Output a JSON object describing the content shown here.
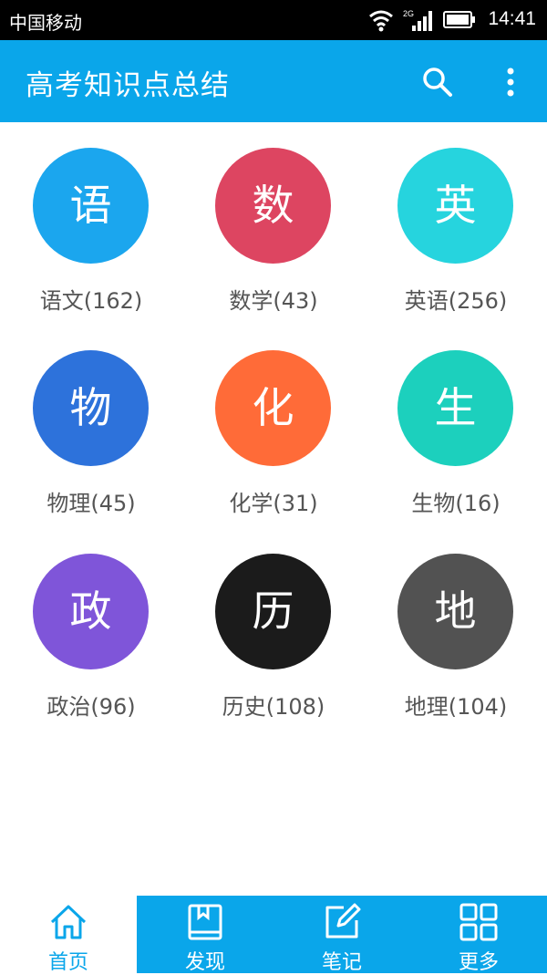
{
  "status": {
    "carrier": "中国移动",
    "network": "2G",
    "time": "14:41"
  },
  "appbar": {
    "title": "高考知识点总结"
  },
  "subjects": [
    {
      "glyph": "语",
      "label": "语文(162)",
      "color": "#1ba6ee"
    },
    {
      "glyph": "数",
      "label": "数学(43)",
      "color": "#dd4561"
    },
    {
      "glyph": "英",
      "label": "英语(256)",
      "color": "#26d4de"
    },
    {
      "glyph": "物",
      "label": "物理(45)",
      "color": "#2d72db"
    },
    {
      "glyph": "化",
      "label": "化学(31)",
      "color": "#ff6b38"
    },
    {
      "glyph": "生",
      "label": "生物(16)",
      "color": "#1cd0bd"
    },
    {
      "glyph": "政",
      "label": "政治(96)",
      "color": "#7f55d9"
    },
    {
      "glyph": "历",
      "label": "历史(108)",
      "color": "#1b1b1b"
    },
    {
      "glyph": "地",
      "label": "地理(104)",
      "color": "#525252"
    }
  ],
  "tabs": [
    {
      "label": "首页",
      "icon": "home-icon",
      "active": true
    },
    {
      "label": "发现",
      "icon": "book-icon",
      "active": false
    },
    {
      "label": "笔记",
      "icon": "edit-icon",
      "active": false
    },
    {
      "label": "更多",
      "icon": "grid-icon",
      "active": false
    }
  ]
}
